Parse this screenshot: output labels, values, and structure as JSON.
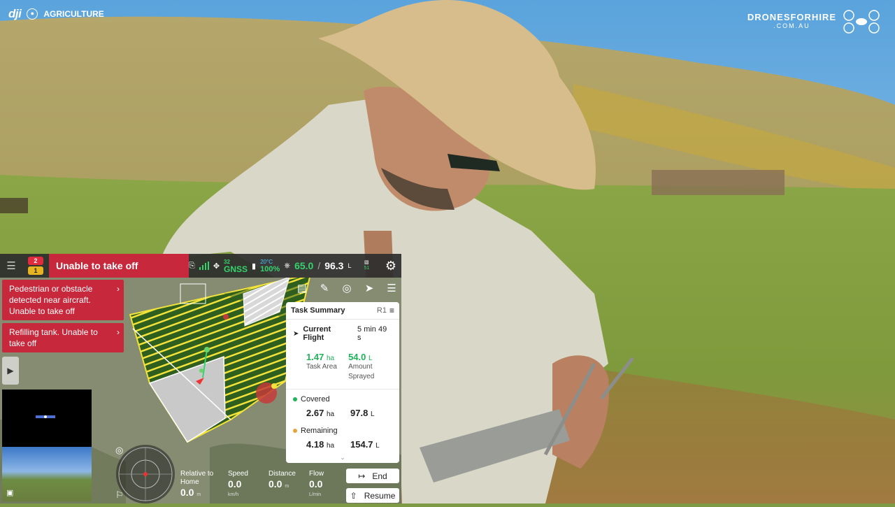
{
  "watermark": {
    "logo": "dji",
    "badge": "AG",
    "label": "AGRICULTURE"
  },
  "brand": {
    "name": "DRONESFORHIRE",
    "domain": ".COM.AU"
  },
  "topbar": {
    "menu_icon": "menu-icon",
    "error_count": "2",
    "warning_count": "1",
    "status_alert": "Unable to take off",
    "signal_label": "",
    "gnss_satellites": "32",
    "gnss_label": "GNSS",
    "battery_temp": "20°C",
    "battery_percent": "100%",
    "tank_value": "65.0",
    "tank_separator": "/",
    "tank_capacity": "96.3",
    "tank_unit": "L",
    "spray_nozzles": "51",
    "settings_icon": "gear-icon"
  },
  "alerts": [
    {
      "text": "Pedestrian or obstacle detected near aircraft. Unable to take off"
    },
    {
      "text": "Refilling tank. Unable to take off"
    }
  ],
  "task_summary": {
    "title": "Task Summary",
    "route": "R1",
    "current_flight_label": "Current Flight",
    "current_flight_time": "5 min 49 s",
    "task_area_value": "1.47",
    "task_area_unit": "ha",
    "task_area_label": "Task Area",
    "amount_sprayed_value": "54.0",
    "amount_sprayed_unit": "L",
    "amount_sprayed_label": "Amount Sprayed",
    "covered_label": "Covered",
    "covered_area": "2.67",
    "covered_area_unit": "ha",
    "covered_volume": "97.8",
    "covered_volume_unit": "L",
    "remaining_label": "Remaining",
    "remaining_area": "4.18",
    "remaining_area_unit": "ha",
    "remaining_volume": "154.7",
    "remaining_volume_unit": "L",
    "colors": {
      "covered": "#1fb35a",
      "remaining": "#e8a33a"
    }
  },
  "flight_stats": {
    "relative_home_label": "Relative to Home",
    "relative_home_value": "0.0",
    "relative_home_unit": "m",
    "speed_label": "Speed",
    "speed_value": "0.0",
    "speed_unit": "km/h",
    "distance_label": "Distance",
    "distance_value": "0.0",
    "distance_unit": "m",
    "flow_label": "Flow",
    "flow_value": "0.0",
    "flow_unit": "L/min"
  },
  "buttons": {
    "end": "End",
    "resume": "Resume"
  },
  "colors": {
    "alert_red": "#c8283c",
    "ok_green": "#35d36b",
    "field_yellow": "#f2e23a"
  }
}
